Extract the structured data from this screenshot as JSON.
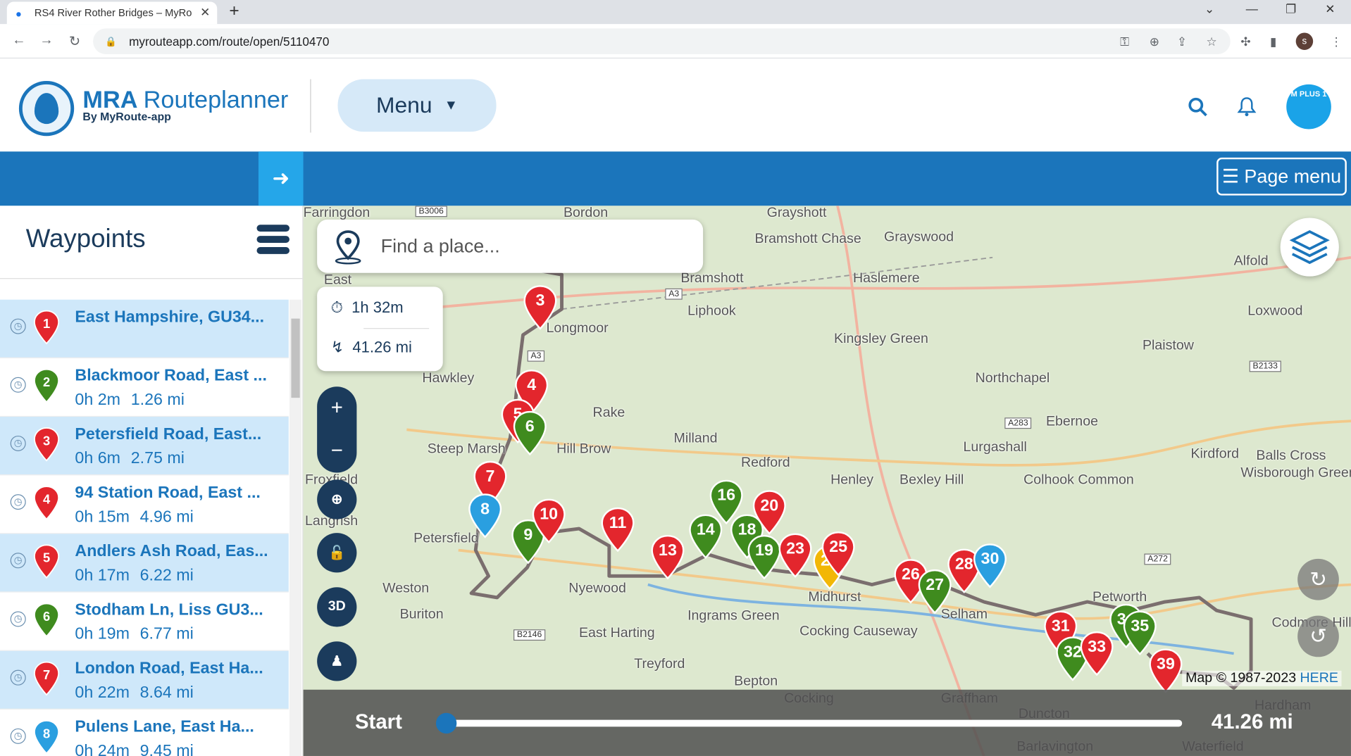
{
  "browser": {
    "tab_title": "RS4 River Rother Bridges – MyRo",
    "url": "myrouteapp.com/route/open/5110470",
    "profile_initial": "s"
  },
  "header": {
    "brand_main": "MRA",
    "brand_light": "Routeplanner",
    "brand_sub": "By MyRoute-app",
    "menu_label": "Menu",
    "plus_badge": "M PLUS 1"
  },
  "toolbar": {
    "page_menu_label": "Page menu"
  },
  "sidebar": {
    "title": "Waypoints",
    "waypoints": [
      {
        "num": "1",
        "color": "#e3262d",
        "name": "East Hampshire, GU34...",
        "time": "",
        "dist": "",
        "start": true
      },
      {
        "num": "2",
        "color": "#3f8b1e",
        "name": "Blackmoor Road, East ...",
        "time": "0h 2m",
        "dist": "1.26 mi"
      },
      {
        "num": "3",
        "color": "#e3262d",
        "name": "Petersfield Road, East...",
        "time": "0h 6m",
        "dist": "2.75 mi"
      },
      {
        "num": "4",
        "color": "#e3262d",
        "name": "94 Station Road, East ...",
        "time": "0h 15m",
        "dist": "4.96 mi"
      },
      {
        "num": "5",
        "color": "#e3262d",
        "name": "Andlers Ash Road, Eas...",
        "time": "0h 17m",
        "dist": "6.22 mi"
      },
      {
        "num": "6",
        "color": "#3f8b1e",
        "name": "Stodham Ln, Liss GU3...",
        "time": "0h 19m",
        "dist": "6.77 mi"
      },
      {
        "num": "7",
        "color": "#e3262d",
        "name": "London Road, East Ha...",
        "time": "0h 22m",
        "dist": "8.64 mi"
      },
      {
        "num": "8",
        "color": "#2a9fe0",
        "name": "Pulens Lane, East Ha...",
        "time": "0h 24m",
        "dist": "9.45 mi"
      }
    ]
  },
  "map": {
    "search_placeholder": "Find a place...",
    "duration": "1h 32m",
    "distance": "41.26 mi",
    "btn_3d": "3D",
    "copyright": "Map © 1987-2023",
    "copyright_link": "HERE",
    "timeline_start": "Start",
    "timeline_end": "41.26 mi",
    "places": [
      "Farringdon",
      "Bordon",
      "Grayshott",
      "Grayswood",
      "Bramshott Chase",
      "Bramshott",
      "Haslemere",
      "Liphook",
      "Alfold",
      "East",
      "Longmoor",
      "Loxwood",
      "Kingsley Green",
      "Plaistow",
      "Hawkley",
      "Northchapel",
      "Rake",
      "Ebernoe",
      "Steep Marsh",
      "Hill Brow",
      "Milland",
      "Lurgashall",
      "Kirdford",
      "Redford",
      "Balls Cross",
      "Froxfield",
      "Henley",
      "Bexley Hill",
      "Colhook Common",
      "Wisborough Green",
      "Langrish",
      "Petersfield",
      "Midhurst",
      "Petworth",
      "Weston",
      "Nyewood",
      "Buriton",
      "Ingrams Green",
      "Cocking Causeway",
      "East Harting",
      "Treyford",
      "Bepton",
      "Codmore Hill",
      "Cocking",
      "Graffham",
      "Duncton",
      "Hardham",
      "Barlavington",
      "Waterfield",
      "Selham"
    ],
    "road_badges": [
      "B3006",
      "A3",
      "A3",
      "B2133",
      "A283",
      "A272",
      "B2146"
    ],
    "markers": [
      {
        "n": "3",
        "c": "#e3262d"
      },
      {
        "n": "4",
        "c": "#e3262d"
      },
      {
        "n": "5",
        "c": "#e3262d"
      },
      {
        "n": "6",
        "c": "#3f8b1e"
      },
      {
        "n": "7",
        "c": "#e3262d"
      },
      {
        "n": "8",
        "c": "#2a9fe0"
      },
      {
        "n": "9",
        "c": "#3f8b1e"
      },
      {
        "n": "10",
        "c": "#e3262d"
      },
      {
        "n": "11",
        "c": "#e3262d"
      },
      {
        "n": "13",
        "c": "#e3262d"
      },
      {
        "n": "14",
        "c": "#3f8b1e"
      },
      {
        "n": "16",
        "c": "#3f8b1e"
      },
      {
        "n": "18",
        "c": "#3f8b1e"
      },
      {
        "n": "19",
        "c": "#3f8b1e"
      },
      {
        "n": "20",
        "c": "#e3262d"
      },
      {
        "n": "23",
        "c": "#e3262d"
      },
      {
        "n": "24",
        "c": "#f2b705"
      },
      {
        "n": "25",
        "c": "#e3262d"
      },
      {
        "n": "26",
        "c": "#e3262d"
      },
      {
        "n": "27",
        "c": "#3f8b1e"
      },
      {
        "n": "28",
        "c": "#e3262d"
      },
      {
        "n": "30",
        "c": "#2a9fe0"
      },
      {
        "n": "31",
        "c": "#e3262d"
      },
      {
        "n": "32",
        "c": "#3f8b1e"
      },
      {
        "n": "33",
        "c": "#e3262d"
      },
      {
        "n": "34",
        "c": "#3f8b1e"
      },
      {
        "n": "35",
        "c": "#3f8b1e"
      },
      {
        "n": "39",
        "c": "#e3262d"
      }
    ]
  },
  "colors": {
    "brand_blue": "#1b75bb",
    "accent_blue": "#25a6e9",
    "red": "#e3262d",
    "green": "#3f8b1e",
    "yellow": "#f2b705"
  }
}
